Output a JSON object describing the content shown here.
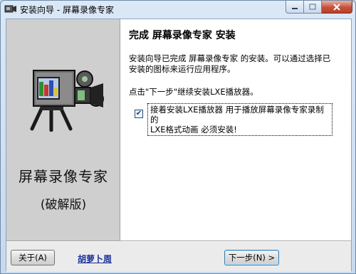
{
  "window": {
    "title": "安装向导 - 屏幕录像专家",
    "icons": {
      "app": "camera-icon",
      "minimize": "minimize-icon",
      "maximize": "maximize-icon",
      "close": "close-icon"
    }
  },
  "sidebar": {
    "image": "video-camera-icon",
    "title": "屏幕录像专家",
    "subtitle": "(破解版)"
  },
  "content": {
    "heading": "完成 屏幕录像专家 安装",
    "paragraph_line1": "安装向导已完成 屏幕录像专家 的安装。可以通过选择已",
    "paragraph_line2": "安装的图标来运行应用程序。",
    "instruction": "点击\"下一步\"继续安装LXE播放器。",
    "checkbox": {
      "checked": true,
      "label_line1": "接着安装LXE播放器 用于播放屏幕录像专家录制的",
      "label_line2": "LXE格式动画 必须安装!"
    }
  },
  "footer": {
    "about_label": "关于(A)",
    "link_text": "胡萝卜周",
    "next_label": "下一步(N) >"
  }
}
